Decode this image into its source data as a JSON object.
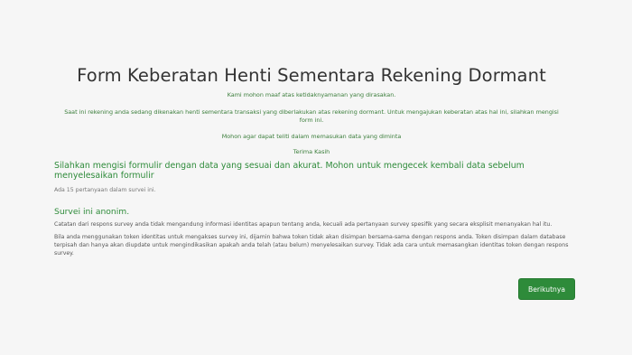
{
  "survey": {
    "title": "Form Keberatan Henti Sementara Rekening Dormant",
    "welcome": {
      "line1": "Kami mohon maaf atas ketidaknyamanan yang dirasakan.",
      "line2": "Saat ini rekening anda sedang dikenakan henti sementara transaksi yang diberlakukan atas rekening dormant. Untuk mengajukan keberatan atas hal ini, silahkan mengisi form ini.",
      "line3": "Mohon agar dapat teliti dalam memasukan data yang diminta",
      "line4": "Terima Kasih"
    },
    "instruction": "Silahkan mengisi formulir dengan data yang sesuai dan akurat. Mohon untuk mengecek kembali data sebelum menyelesaikan formulir",
    "question_count": "Ada 15 pertanyaan dalam survei ini.",
    "anonymous": {
      "title": "Survei ini anonim.",
      "para1": "Catatan dari respons survey anda tidak mengandung informasi identitas apapun tentang anda, kecuali ada pertanyaan survey spesifik yang secara eksplisit menanyakan hal itu.",
      "para2": "Bila anda menggunakan token identitas untuk mengakses survey ini, dijamin bahwa token tidak akan disimpan bersama-sama dengan respons anda. Token disimpan dalam database terpisah dan hanya akan diupdate untuk mengindikasikan apakah anda telah (atau belum) menyelesaikan survey. Tidak ada cara untuk memasangkan identitas token dengan respons survey."
    },
    "next_label": "Berikutnya"
  },
  "colors": {
    "accent": "#2e8b3a",
    "background": "#f6f6f6"
  }
}
